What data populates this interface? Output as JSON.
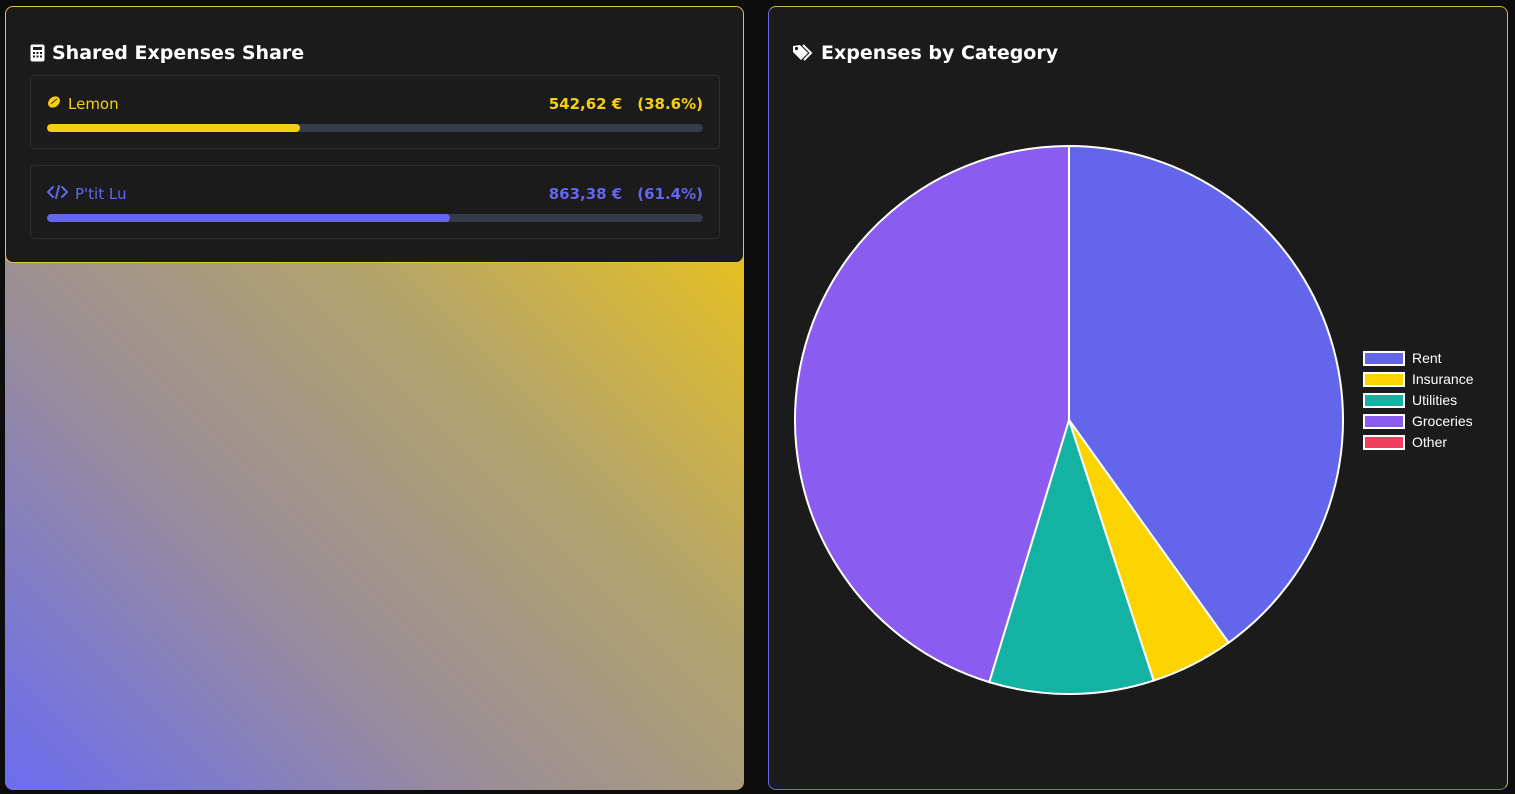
{
  "share_card": {
    "title": "Shared Expenses Share",
    "people": [
      {
        "name": "Lemon",
        "amount": "542,62 €",
        "percent": "(38.6%)",
        "share": 0.386,
        "color": "#f7cf12"
      },
      {
        "name": "P'tit Lu",
        "amount": "863,38 €",
        "percent": "(61.4%)",
        "share": 0.614,
        "color": "#6466ec"
      }
    ]
  },
  "category_card": {
    "title": "Expenses by Category"
  },
  "chart_data": {
    "type": "pie",
    "title": "Expenses by Category",
    "categories": [
      "Rent",
      "Insurance",
      "Utilities",
      "Groceries",
      "Other"
    ],
    "values": [
      40.1,
      4.9,
      9.7,
      45.3,
      0
    ],
    "colors": [
      "#6366ea",
      "#fbd400",
      "#14b2a3",
      "#8b5cf0",
      "#f03e5c"
    ],
    "legend_position": "right"
  }
}
